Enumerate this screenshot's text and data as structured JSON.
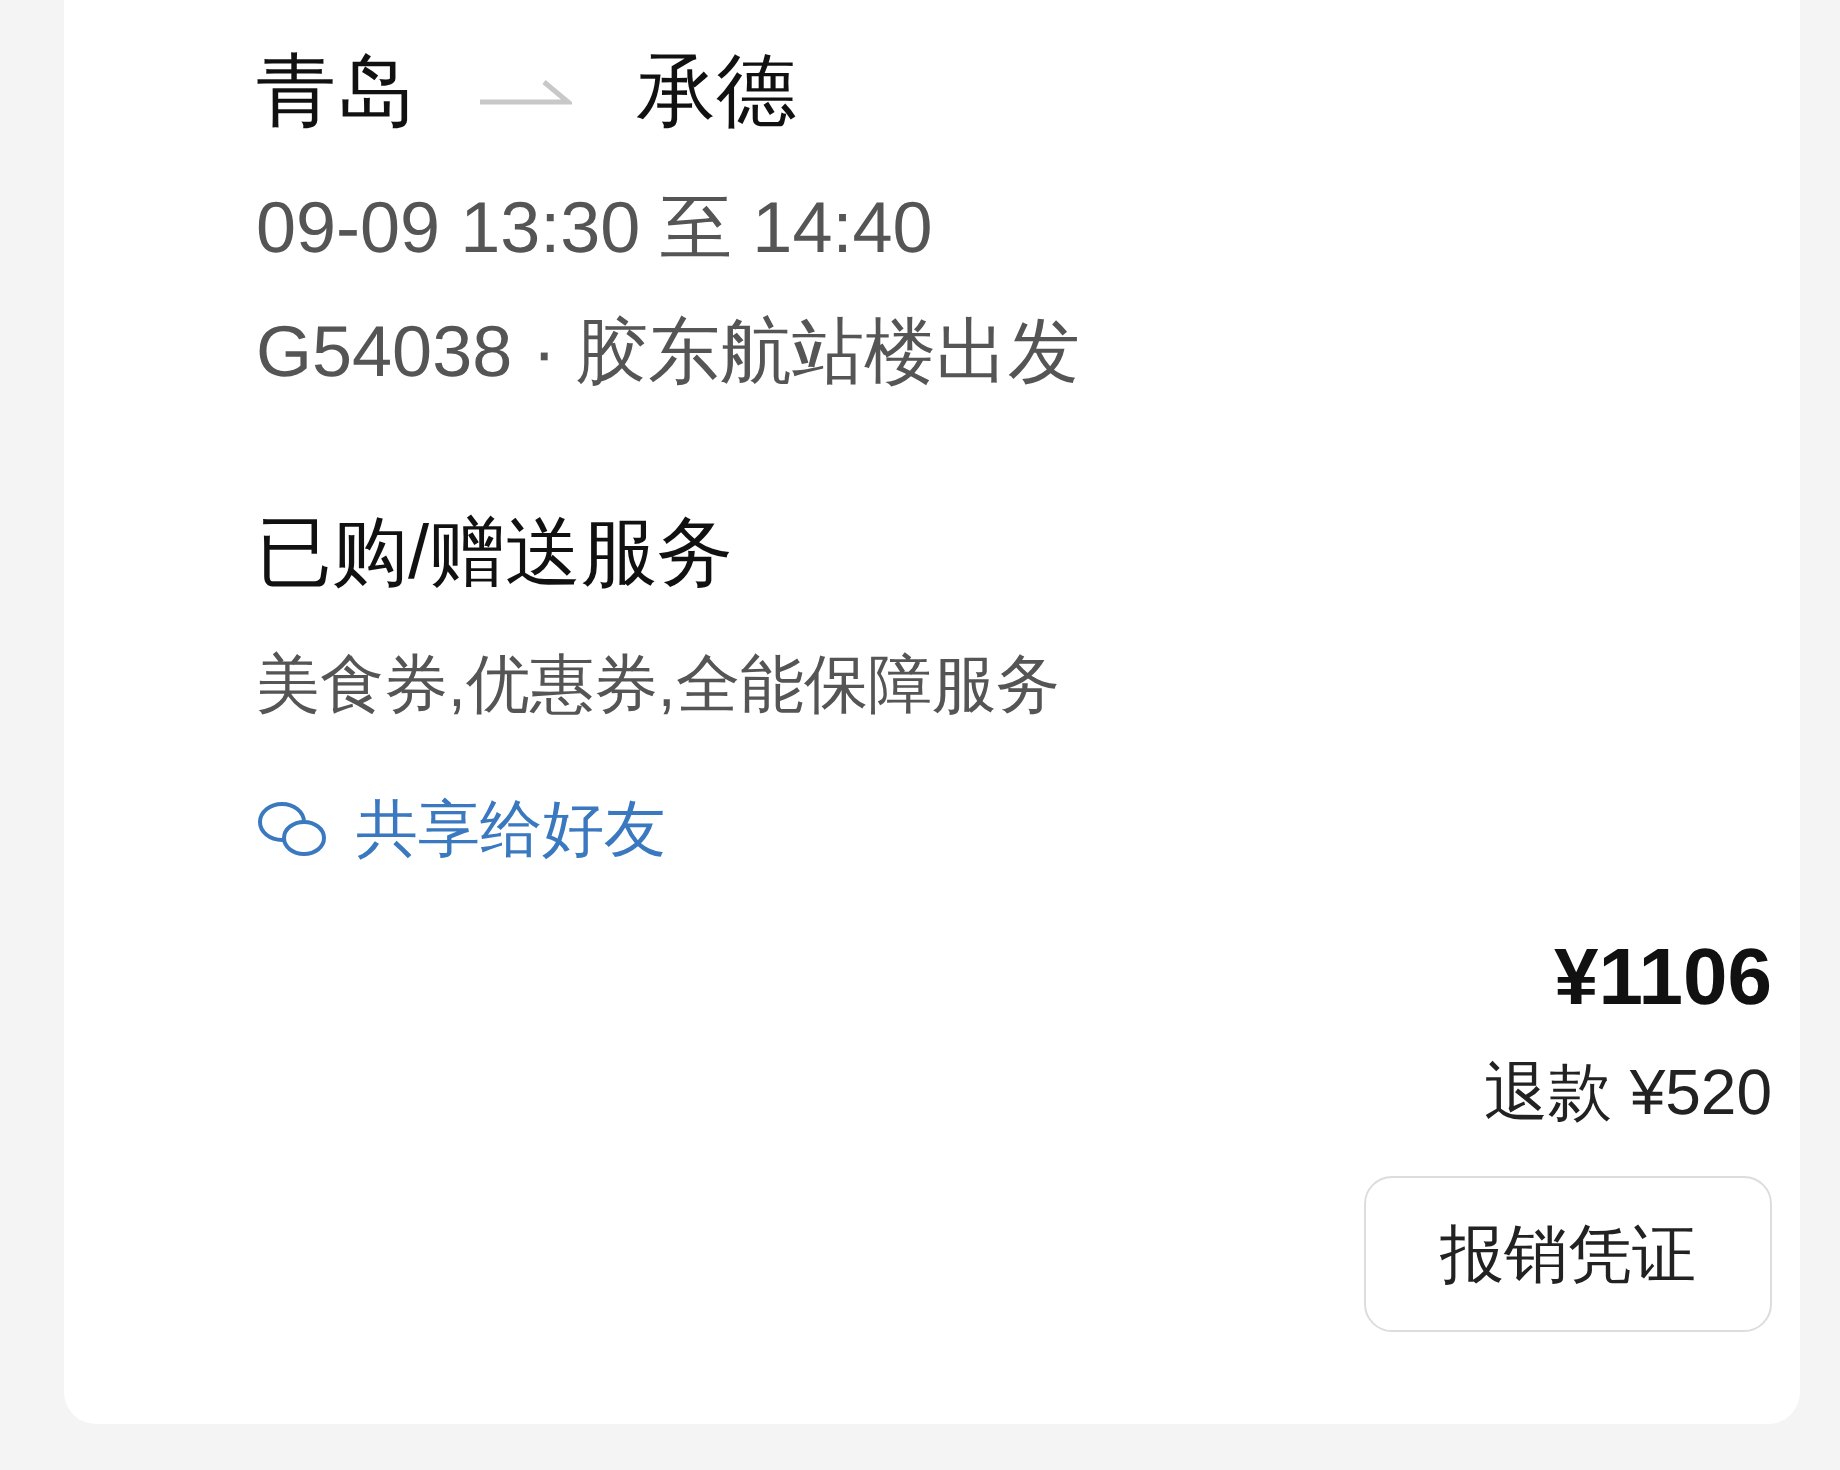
{
  "trip": {
    "from": "青岛",
    "to": "承德",
    "time": "09-09 13:30 至 14:40",
    "train": "G54038 · 胶东航站楼出发"
  },
  "services": {
    "heading": "已购/赠送服务",
    "items": "美食券,优惠券,全能保障服务"
  },
  "share": {
    "label": "共享给好友"
  },
  "price": {
    "total": "¥1106",
    "refund": "退款 ¥520"
  },
  "buttons": [
    "报销凭证"
  ]
}
